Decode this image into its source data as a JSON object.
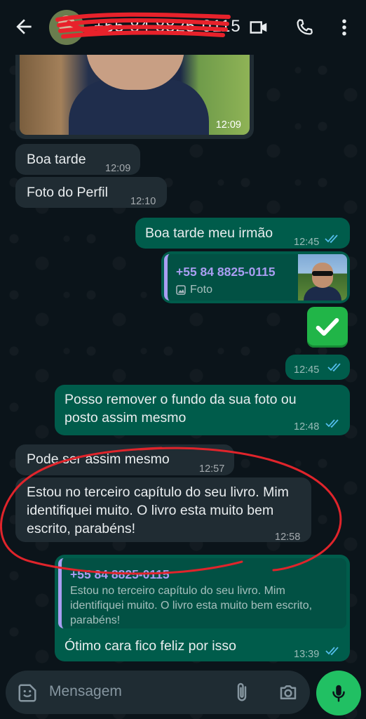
{
  "header": {
    "contact_name": "+55 84 8825-0115",
    "back_icon": "arrow-left-icon",
    "video_icon": "video-camera-icon",
    "call_icon": "phone-icon",
    "menu_icon": "more-vert-icon"
  },
  "messages": [
    {
      "dir": "in",
      "type": "image",
      "time": "12:09"
    },
    {
      "dir": "in",
      "text": "Boa tarde",
      "time": "12:09"
    },
    {
      "dir": "in",
      "text": "Foto do Perfil",
      "time": "12:10"
    },
    {
      "dir": "out",
      "text": "Boa tarde meu irmão",
      "time": "12:45",
      "status": "read"
    },
    {
      "dir": "out",
      "type": "contact-photo-reply",
      "reply_name": "+55 84 8825-0115",
      "reply_label": "Foto",
      "time": ""
    },
    {
      "dir": "out",
      "type": "emoji",
      "emoji": "check-mark-button",
      "time": "12:45",
      "status": "read"
    },
    {
      "dir": "out",
      "text": "Posso remover o fundo da sua foto ou posto assim mesmo",
      "time": "12:48",
      "status": "read"
    },
    {
      "dir": "in",
      "text": "Pode ser assim mesmo",
      "time": "12:57"
    },
    {
      "dir": "in",
      "text": "Estou no terceiro capítulo do seu livro. Mim identifiquei muito.  O livro esta muito bem escrito, parabéns!",
      "time": "12:58"
    },
    {
      "dir": "out",
      "type": "quoted-reply",
      "quote_name": "+55 84 8825-0115",
      "quote_text": "Estou no terceiro capítulo do seu livro. Mim identifiquei muito.  O livro esta muito bem escrito, parabéns!",
      "text": "Ótimo cara fico feliz por isso",
      "time": "13:39",
      "status": "read"
    }
  ],
  "composer": {
    "placeholder": "Mensagem",
    "emoji_icon": "sticker-icon",
    "attach_icon": "paperclip-icon",
    "camera_icon": "camera-icon",
    "mic_icon": "microphone-icon"
  },
  "colors": {
    "background": "#0b141a",
    "incoming_bubble": "#202c33",
    "outgoing_bubble": "#005c4b",
    "read_ticks": "#53bdeb",
    "mic_button": "#21c063",
    "annotation_stroke": "#e0242b"
  }
}
